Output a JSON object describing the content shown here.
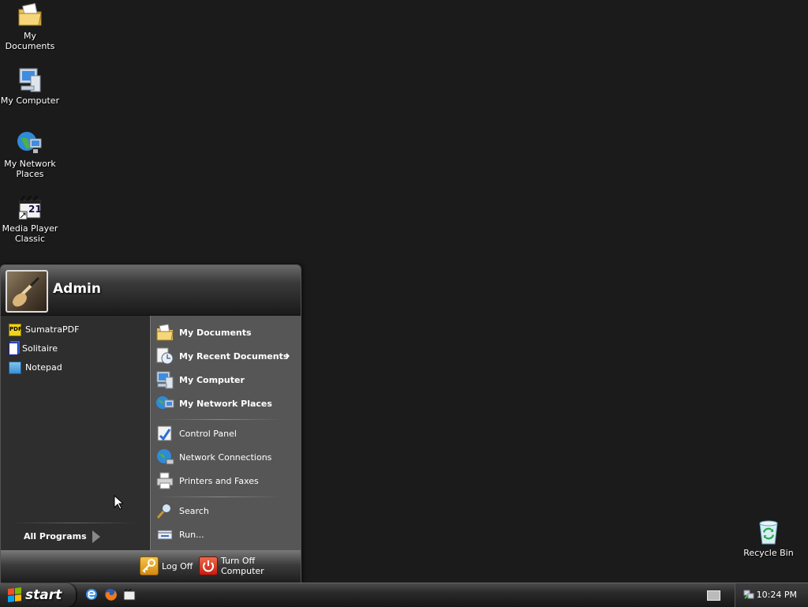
{
  "desktop": {
    "icons": [
      {
        "label": "My Documents",
        "icon": "folder-documents-icon"
      },
      {
        "label": "My Computer",
        "icon": "computer-icon"
      },
      {
        "label": "My Network Places",
        "icon": "network-places-icon"
      },
      {
        "label": "Media Player Classic",
        "icon": "media-player-icon"
      },
      {
        "label": "Recycle Bin",
        "icon": "recycle-bin-icon"
      }
    ],
    "mpc_badge": "21"
  },
  "start_menu": {
    "user_name": "Admin",
    "pinned": [
      {
        "label": "SumatraPDF",
        "icon": "sumatrapdf-icon"
      },
      {
        "label": "Solitaire",
        "icon": "solitaire-icon"
      },
      {
        "label": "Notepad",
        "icon": "notepad-icon"
      }
    ],
    "all_programs": "All Programs",
    "right_items": [
      {
        "label": "My Documents",
        "icon": "folder-documents-icon",
        "bold": true
      },
      {
        "label": "My Recent Documents",
        "icon": "recent-documents-icon",
        "bold": true,
        "submenu": true
      },
      {
        "label": "My Computer",
        "icon": "computer-icon",
        "bold": true
      },
      {
        "label": "My Network Places",
        "icon": "network-places-icon",
        "bold": true
      },
      {
        "label": "Control Panel",
        "icon": "control-panel-icon",
        "bold": false
      },
      {
        "label": "Network Connections",
        "icon": "network-connections-icon",
        "bold": false
      },
      {
        "label": "Printers and Faxes",
        "icon": "printer-icon",
        "bold": false
      },
      {
        "label": "Search",
        "icon": "search-icon",
        "bold": false
      },
      {
        "label": "Run...",
        "icon": "run-icon",
        "bold": false
      }
    ],
    "log_off": "Log Off",
    "turn_off": "Turn Off Computer"
  },
  "taskbar": {
    "start_label": "start",
    "quick_launch": [
      "internet-explorer-icon",
      "firefox-icon",
      "media-player-icon"
    ],
    "clock": "10:24 PM"
  },
  "colors": {
    "desktop_bg": "#1b1b1b",
    "menu_right_bg": "#565656",
    "menu_left_bg": "#2e2e2e",
    "logoff_accent": "#e8a424",
    "turnoff_accent": "#d92a1c"
  }
}
